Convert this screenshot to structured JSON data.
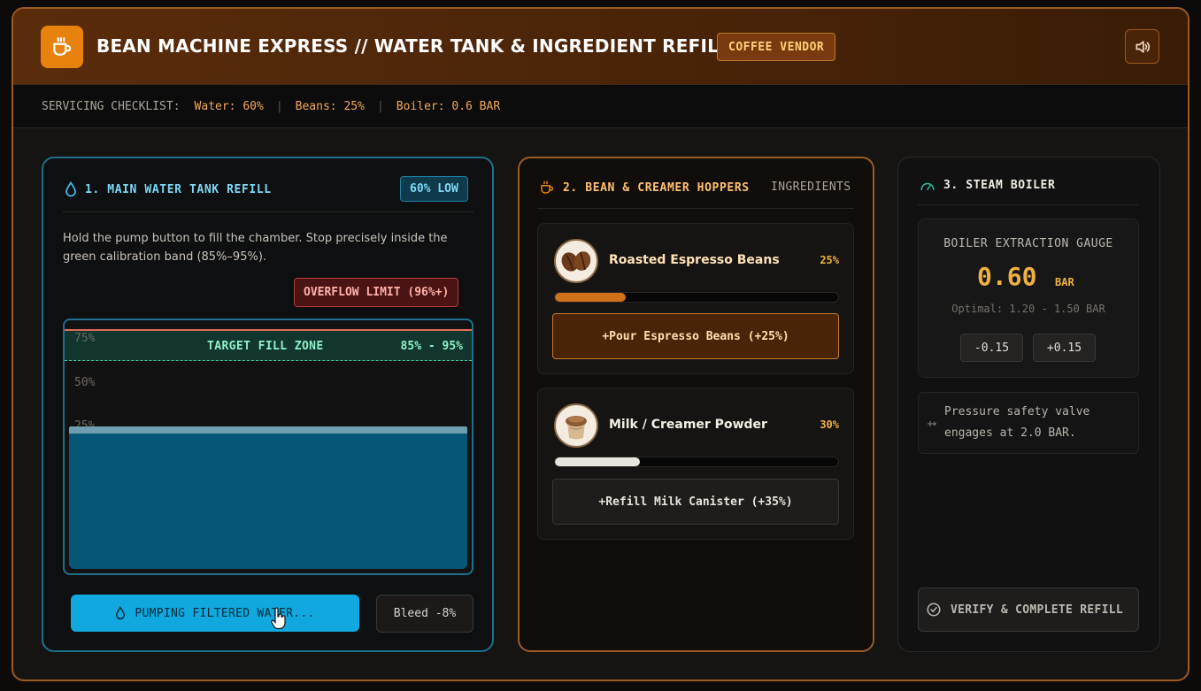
{
  "header": {
    "title": "BEAN MACHINE EXPRESS // WATER TANK & INGREDIENT REFILL",
    "vendor_badge": "COFFEE VENDOR",
    "logo_icon": "coffee-cup-icon",
    "sound_icon": "speaker-icon",
    "accent_color": "#e8820e"
  },
  "checklist": {
    "label": "SERVICING CHECKLIST:",
    "water": "Water: 60%",
    "beans": "Beans: 25%",
    "boiler": "Boiler: 0.6 BAR"
  },
  "water_panel": {
    "title": "1. MAIN WATER TANK REFILL",
    "level_badge": "60% LOW",
    "instructions": "Hold the pump button to fill the chamber. Stop precisely inside the green calibration band (85%–95%).",
    "overflow_label": "OVERFLOW LIMIT (96%+)",
    "target_zone_label": "TARGET FILL ZONE",
    "target_zone_range": "85% - 95%",
    "ticks": [
      "75%",
      "50%",
      "25%"
    ],
    "fill_percent": 60,
    "pump_button": "PUMPING FILTERED WATER...",
    "bleed_button": "Bleed -8%",
    "water_color": "#065677"
  },
  "ingredients_panel": {
    "title": "2. BEAN & CREAMER HOPPERS",
    "subtitle": "INGREDIENTS",
    "items": [
      {
        "name": "Roasted Espresso Beans",
        "percent_label": "25%",
        "level": 0.25,
        "button": "+Pour Espresso Beans (+25%)",
        "bar_color": "#d0701a"
      },
      {
        "name": "Milk / Creamer Powder",
        "percent_label": "30%",
        "level": 0.3,
        "button": "+Refill Milk Canister (+35%)",
        "bar_color": "#e8e4de"
      }
    ]
  },
  "boiler_panel": {
    "title": "3. STEAM BOILER",
    "gauge_title": "BOILER EXTRACTION GAUGE",
    "value": "0.60",
    "unit": "BAR",
    "optimal": "Optimal: 1.20 - 1.50 BAR",
    "minus_button": "-0.15",
    "plus_button": "+0.15",
    "valve_note": "Pressure safety valve engages at 2.0 BAR.",
    "verify_button": "VERIFY & COMPLETE REFILL"
  }
}
